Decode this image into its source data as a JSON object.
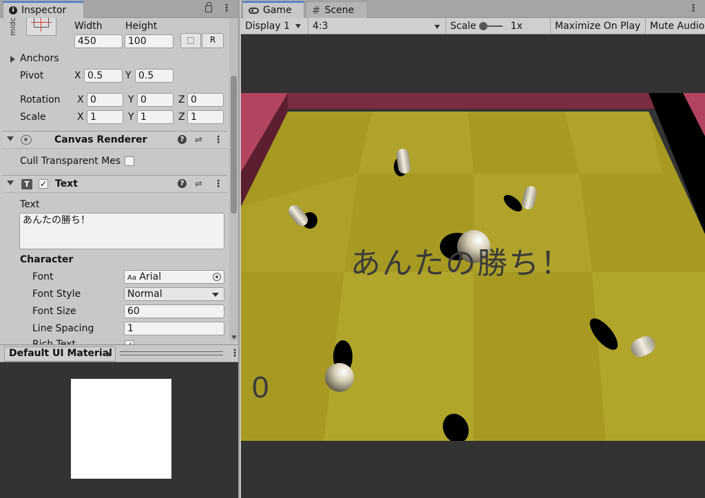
{
  "inspector": {
    "tab_title": "Inspector",
    "anchor_preset_label": "midc",
    "rect": {
      "width_label": "Width",
      "height_label": "Height",
      "width_value": "450",
      "height_value": "100",
      "blueprint_btn": "⬚",
      "raw_btn": "R",
      "anchors_label": "Anchors",
      "pivot_label": "Pivot",
      "pivot_x": "0.5",
      "pivot_y": "0.5",
      "rotation_label": "Rotation",
      "rot_x": "0",
      "rot_y": "0",
      "rot_z": "0",
      "scale_label": "Scale",
      "scale_x": "1",
      "scale_y": "1",
      "scale_z": "1",
      "axis_x": "X",
      "axis_y": "Y",
      "axis_z": "Z"
    },
    "canvas_renderer": {
      "title": "Canvas Renderer",
      "cull_label": "Cull Transparent Mes"
    },
    "text_component": {
      "title": "Text",
      "text_label": "Text",
      "text_value": "あんたの勝ち！",
      "character_label": "Character",
      "font_label": "Font",
      "font_value": "Arial",
      "font_prefix": "Aa",
      "font_style_label": "Font Style",
      "font_style_value": "Normal",
      "font_size_label": "Font Size",
      "font_size_value": "60",
      "line_spacing_label": "Line Spacing",
      "line_spacing_value": "1",
      "rich_text_label": "Rich Text"
    },
    "material": {
      "title": "Default UI Material"
    }
  },
  "game": {
    "tab_game": "Game",
    "tab_scene": "Scene",
    "toolbar": {
      "display": "Display 1",
      "aspect": "4:3",
      "scale_label": "Scale",
      "scale_value": "1x",
      "maximize": "Maximize On Play",
      "mute": "Mute Audio"
    },
    "win_text": "あんたの勝ち！",
    "score": "0"
  }
}
